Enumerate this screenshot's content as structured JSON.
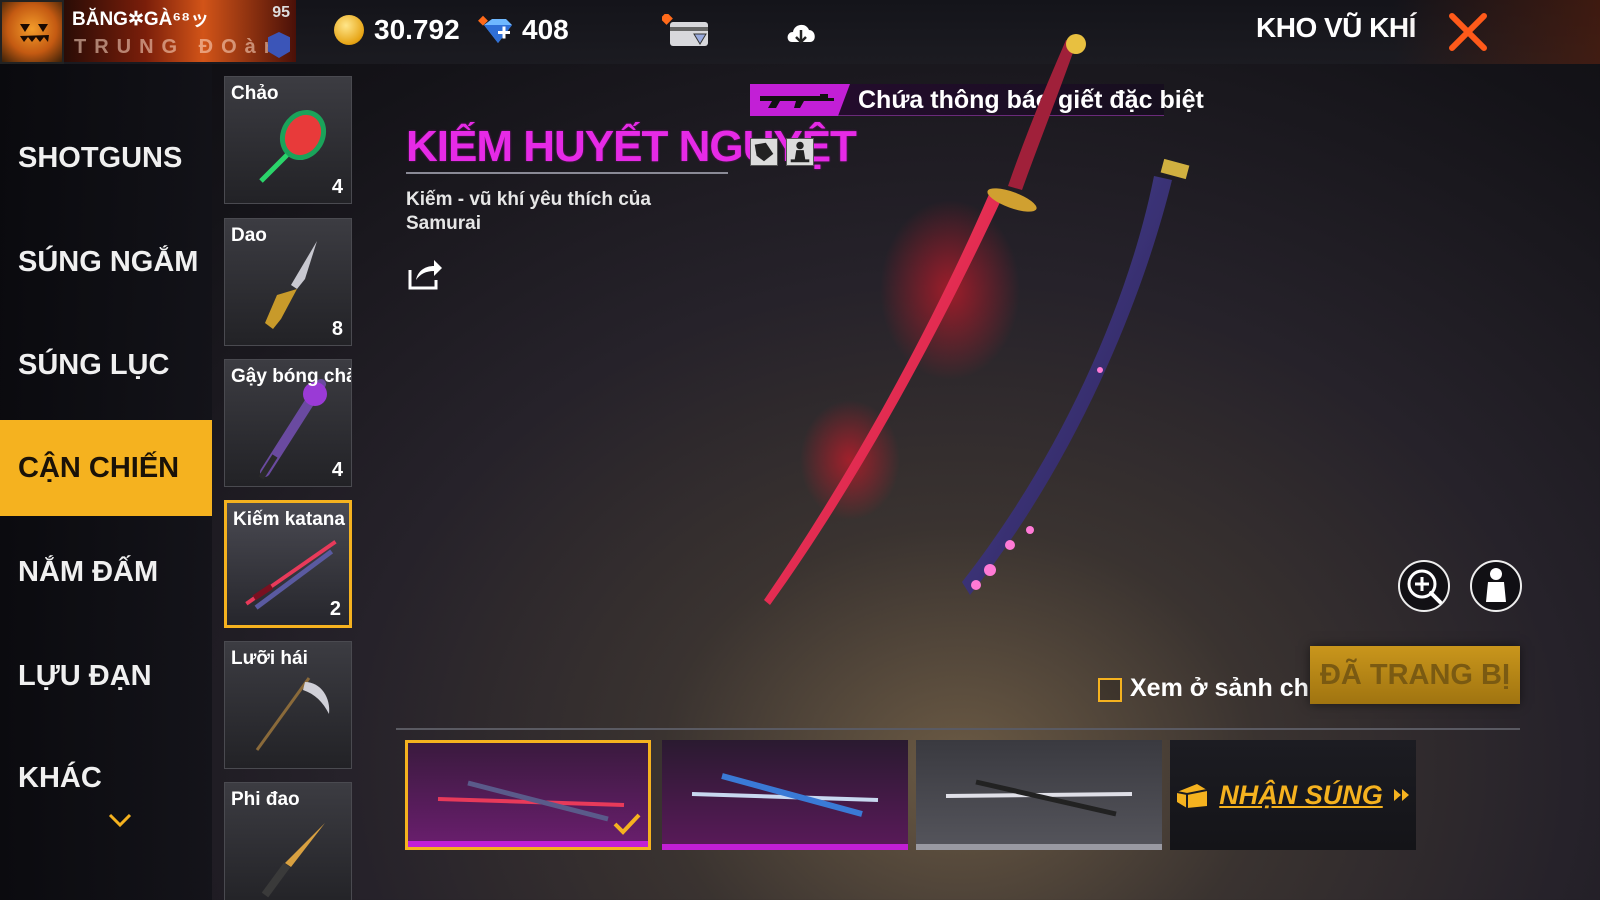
{
  "player": {
    "name": "BĂNG✲GÀ⁶⁸ッ",
    "level": "95",
    "guild": "TRUNG ĐOàn"
  },
  "currencies": {
    "gold": "30.792",
    "diamonds": "408"
  },
  "header": {
    "title": "KHO VŨ KHÍ"
  },
  "categories": [
    {
      "label": "SHOTGUNS",
      "active": false
    },
    {
      "label": "SÚNG NGẮM",
      "active": false
    },
    {
      "label": "SÚNG LỤC",
      "active": false
    },
    {
      "label": "CẬN CHIẾN",
      "active": true
    },
    {
      "label": "NẮM ĐẤM",
      "active": false
    },
    {
      "label": "LỰU ĐẠN",
      "active": false
    },
    {
      "label": "KHÁC",
      "active": false
    }
  ],
  "items": [
    {
      "name": "Chảo",
      "count": "4",
      "icon": "pan-icon"
    },
    {
      "name": "Dao",
      "count": "8",
      "icon": "knife-icon"
    },
    {
      "name": "Gậy bóng chày",
      "count": "4",
      "icon": "bat-icon"
    },
    {
      "name": "Kiếm katana",
      "count": "2",
      "icon": "katana-icon",
      "selected": true
    },
    {
      "name": "Lưỡi hái",
      "count": "",
      "icon": "scythe-icon"
    },
    {
      "name": "Phi đao",
      "count": "",
      "icon": "throwing-knife-icon"
    }
  ],
  "weapon": {
    "name": "KIẾM HUYẾT NGUYỆT",
    "description": "Kiếm - vũ khí yêu thích của Samurai",
    "kill_notice": "Chứa thông báo giết đặc biệt"
  },
  "controls": {
    "lobby_label": "Xem ở sảnh chờ",
    "equipped_label": "ĐÃ TRANG BỊ",
    "get_gun_label": "NHẬN SÚNG"
  },
  "colors": {
    "accent": "#f5b21f",
    "weapon_name": "#e62ae6",
    "kill_badge": "#c21fd6"
  }
}
